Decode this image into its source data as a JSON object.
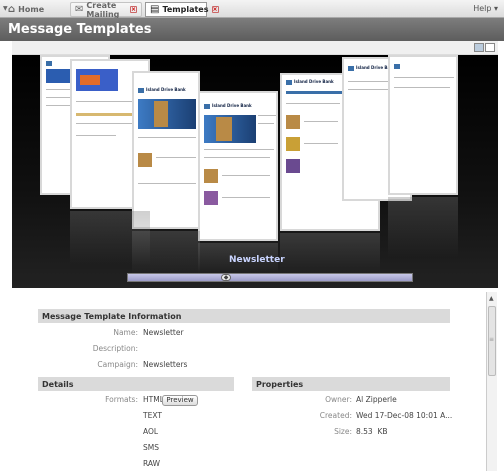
{
  "tabs": [
    {
      "label": "Home"
    },
    {
      "label": "Create Mailing"
    },
    {
      "label": "Templates"
    }
  ],
  "help_label": "Help",
  "page_title": "Message Templates",
  "carousel": {
    "selected_caption": "Newsletter"
  },
  "info": {
    "section_title": "Message Template Information",
    "name_label": "Name:",
    "name_value": "Newsletter",
    "description_label": "Description:",
    "description_value": "",
    "campaign_label": "Campaign:",
    "campaign_value": "Newsletters"
  },
  "details": {
    "section_title": "Details",
    "formats_label": "Formats:",
    "formats": [
      "HTML",
      "TEXT",
      "AOL",
      "SMS",
      "RAW"
    ],
    "preview_label": "Preview"
  },
  "properties": {
    "section_title": "Properties",
    "owner_label": "Owner:",
    "owner_value": "Al Zipperle",
    "created_label": "Created:",
    "created_value": "Wed 17-Dec-08 10:01 A...",
    "size_label": "Size:",
    "size_value": "8.53  KB"
  }
}
